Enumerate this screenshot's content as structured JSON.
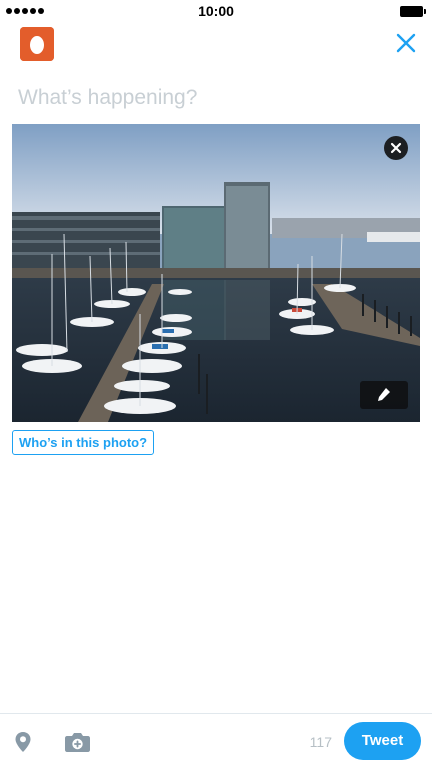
{
  "status_bar": {
    "time": "10:00",
    "signal_dots": 5
  },
  "header": {
    "avatar_icon": "egg-avatar-icon",
    "close_icon": "close-x-icon",
    "accent_color": "#1da1f2",
    "avatar_color": "#e35d2b"
  },
  "composer": {
    "placeholder": "What’s happening?",
    "value": ""
  },
  "photo": {
    "remove_icon": "close-circle-icon",
    "edit_icon": "pencil-icon",
    "tag_people_label": "Who’s in this photo?"
  },
  "toolbar": {
    "location_icon": "location-pin-icon",
    "camera_icon": "camera-add-icon",
    "char_count": "117",
    "tweet_label": "Tweet"
  }
}
